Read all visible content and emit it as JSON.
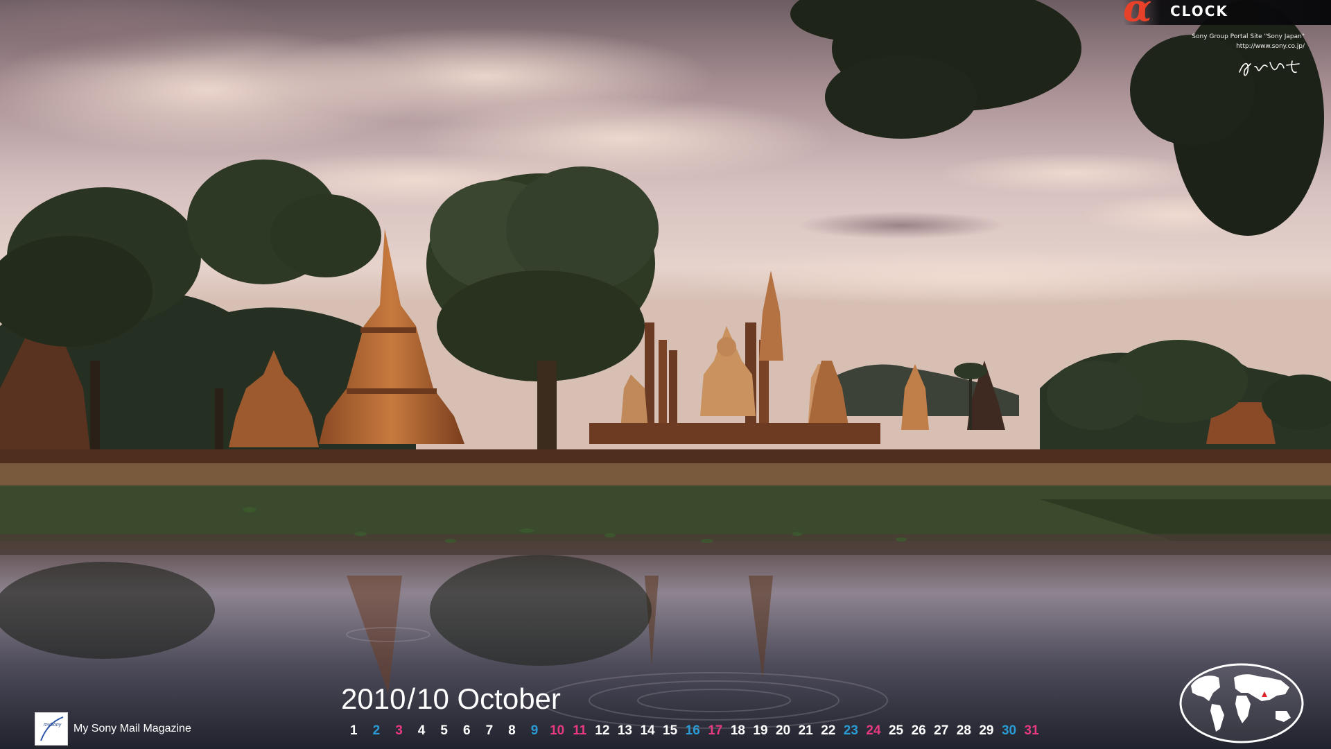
{
  "brand": {
    "word": "CLOCK",
    "alpha_glyph": "α",
    "alpha_color": "#e8412a",
    "credit_line1": "Sony Group Portal Site \"Sony Japan\"",
    "credit_line2": "http://www.sony.co.jp/"
  },
  "mysony": {
    "logo_text": "mySony",
    "label": "My Sony Mail Magazine"
  },
  "calendar": {
    "year": "2010",
    "separator": "/",
    "month_num": "10",
    "month_name": "October",
    "days": [
      {
        "d": "1",
        "t": "weekday"
      },
      {
        "d": "2",
        "t": "sat"
      },
      {
        "d": "3",
        "t": "sun"
      },
      {
        "d": "4",
        "t": "weekday"
      },
      {
        "d": "5",
        "t": "weekday"
      },
      {
        "d": "6",
        "t": "weekday"
      },
      {
        "d": "7",
        "t": "weekday"
      },
      {
        "d": "8",
        "t": "weekday"
      },
      {
        "d": "9",
        "t": "sat"
      },
      {
        "d": "10",
        "t": "sun"
      },
      {
        "d": "11",
        "t": "sun"
      },
      {
        "d": "12",
        "t": "weekday"
      },
      {
        "d": "13",
        "t": "weekday"
      },
      {
        "d": "14",
        "t": "weekday"
      },
      {
        "d": "15",
        "t": "weekday"
      },
      {
        "d": "16",
        "t": "sat"
      },
      {
        "d": "17",
        "t": "sun"
      },
      {
        "d": "18",
        "t": "weekday"
      },
      {
        "d": "19",
        "t": "weekday"
      },
      {
        "d": "20",
        "t": "weekday"
      },
      {
        "d": "21",
        "t": "weekday"
      },
      {
        "d": "22",
        "t": "weekday"
      },
      {
        "d": "23",
        "t": "sat"
      },
      {
        "d": "24",
        "t": "sun"
      },
      {
        "d": "25",
        "t": "weekday"
      },
      {
        "d": "26",
        "t": "weekday"
      },
      {
        "d": "27",
        "t": "weekday"
      },
      {
        "d": "28",
        "t": "weekday"
      },
      {
        "d": "29",
        "t": "weekday"
      },
      {
        "d": "30",
        "t": "sat"
      },
      {
        "d": "31",
        "t": "sun"
      }
    ],
    "colors": {
      "weekday": "#ffffff",
      "sat": "#2a9ad1",
      "sun": "#e63a80"
    }
  },
  "globe": {
    "marker_color": "#e0242b"
  }
}
